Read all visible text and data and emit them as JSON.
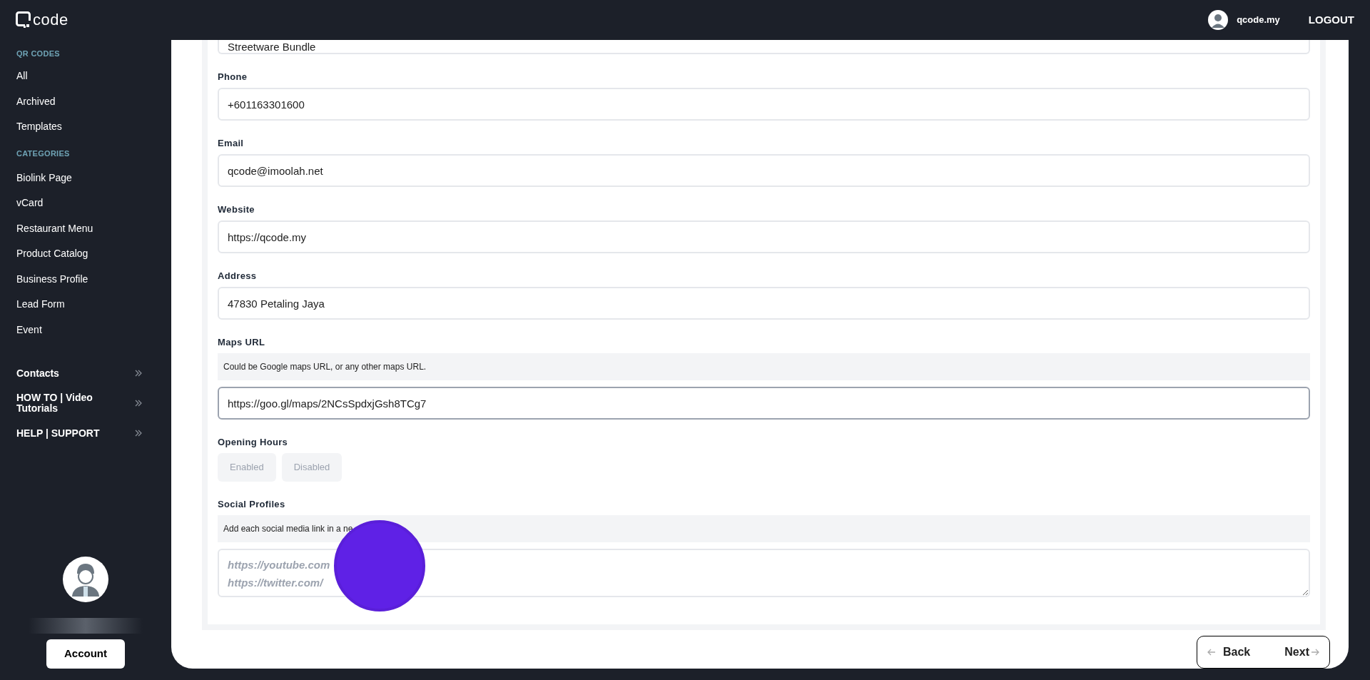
{
  "header": {
    "logo": "code",
    "user": "qcode.my",
    "logout": "LOGOUT"
  },
  "sidebar": {
    "sections": [
      {
        "heading": "QR CODES",
        "items": [
          {
            "label": "All",
            "submenu": false
          },
          {
            "label": "Archived",
            "submenu": false
          },
          {
            "label": "Templates",
            "submenu": false
          }
        ]
      },
      {
        "heading": "CATEGORIES",
        "items": [
          {
            "label": "Biolink Page",
            "submenu": false
          },
          {
            "label": "vCard",
            "submenu": false
          },
          {
            "label": "Restaurant Menu",
            "submenu": false
          },
          {
            "label": "Product Catalog",
            "submenu": false
          },
          {
            "label": "Business Profile",
            "submenu": false
          },
          {
            "label": "Lead Form",
            "submenu": false
          },
          {
            "label": "Event",
            "submenu": false
          }
        ]
      },
      {
        "items": [
          {
            "label": "Contacts",
            "submenu": true
          },
          {
            "label": "HOW TO | Video Tutorials",
            "submenu": true
          },
          {
            "label": "HELP | SUPPORT",
            "submenu": true
          }
        ]
      }
    ],
    "account_button": "Account"
  },
  "form": [
    {
      "kind": "input",
      "value": "Streetware Bundle",
      "focused": false
    },
    {
      "kind": "label",
      "text": "Phone"
    },
    {
      "kind": "input",
      "value": "+601163301600",
      "focused": false
    },
    {
      "kind": "label",
      "text": "Email"
    },
    {
      "kind": "input",
      "value": "qcode@imoolah.net",
      "focused": false
    },
    {
      "kind": "label",
      "text": "Website"
    },
    {
      "kind": "input",
      "value": "https://qcode.my",
      "focused": false
    },
    {
      "kind": "label",
      "text": "Address"
    },
    {
      "kind": "input",
      "value": "47830 Petaling Jaya",
      "focused": false
    },
    {
      "kind": "label",
      "text": "Maps URL"
    },
    {
      "kind": "hint",
      "text": "Could be Google maps URL, or any other maps URL."
    },
    {
      "kind": "input",
      "value": "https://goo.gl/maps/2NCsSpdxjGsh8TCg7",
      "focused": true
    },
    {
      "kind": "label",
      "text": "Opening Hours"
    },
    {
      "kind": "toggle",
      "options": [
        "Enabled",
        "Disabled"
      ]
    },
    {
      "kind": "label",
      "text": "Social Profiles"
    },
    {
      "kind": "hint",
      "text": "Add each social media link in a ne"
    },
    {
      "kind": "textarea",
      "placeholder_lines": [
        "https://youtube.com",
        "https://twitter.com/"
      ]
    }
  ],
  "nav": {
    "back": "Back",
    "next": "Next"
  }
}
